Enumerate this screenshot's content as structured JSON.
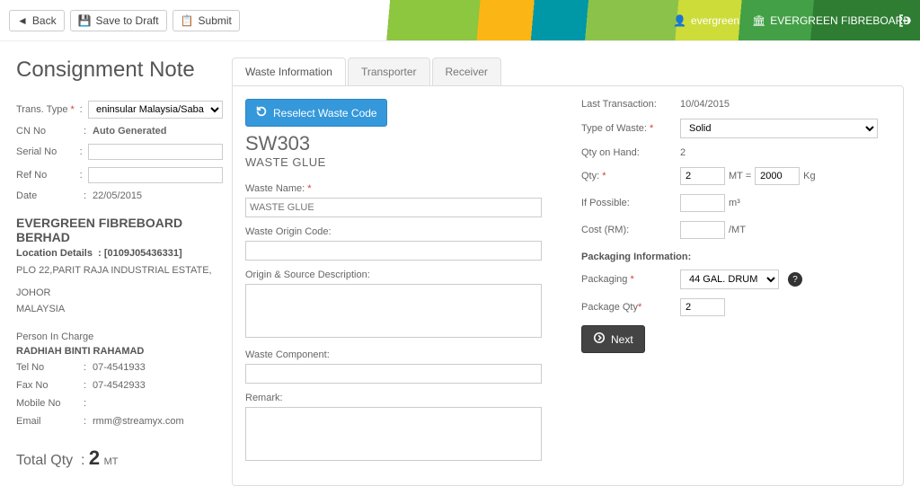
{
  "topbar": {
    "back": "Back",
    "save_draft": "Save to Draft",
    "submit": "Submit",
    "username": "evergreen",
    "orgname": "EVERGREEN FIBREBOARD"
  },
  "left": {
    "title": "Consignment Note",
    "fields": {
      "trans_type_label": "Trans. Type",
      "trans_type_value": "eninsular Malaysia/Sabah/Sarawak",
      "cn_no_label": "CN No",
      "cn_no_value": "Auto Generated",
      "serial_label": "Serial No",
      "serial_value": "",
      "ref_label": "Ref No",
      "ref_value": "",
      "date_label": "Date",
      "date_value": "22/05/2015"
    },
    "company": "EVERGREEN FIBREBOARD BERHAD",
    "location_label": "Location Details",
    "location_code": "[0109J05436331]",
    "address_line1": "PLO 22,PARIT RAJA INDUSTRIAL ESTATE,",
    "address_line2": "JOHOR",
    "address_line3": "MALAYSIA",
    "pic_label": "Person In Charge",
    "pic_name": "RADHIAH BINTI RAHAMAD",
    "contact": {
      "tel_label": "Tel No",
      "tel_value": "07-4541933",
      "fax_label": "Fax No",
      "fax_value": "07-4542933",
      "mobile_label": "Mobile No",
      "mobile_value": "",
      "email_label": "Email",
      "email_value": "rmm@streamyx.com"
    },
    "total_label": "Total Qty",
    "total_value": "2",
    "total_unit": "MT"
  },
  "tabs": {
    "waste": "Waste Information",
    "transporter": "Transporter",
    "receiver": "Receiver"
  },
  "waste": {
    "reselect": "Reselect Waste Code",
    "code": "SW303",
    "code_name": "WASTE GLUE",
    "name_label": "Waste Name:",
    "name_placeholder": "WASTE GLUE",
    "origin_code_label": "Waste Origin Code:",
    "origin_desc_label": "Origin & Source Description:",
    "component_label": "Waste Component:",
    "remark_label": "Remark:"
  },
  "info": {
    "last_trans_label": "Last Transaction:",
    "last_trans_value": "10/04/2015",
    "type_label": "Type of Waste:",
    "type_value": "Solid",
    "qoh_label": "Qty on Hand:",
    "qoh_value": "2",
    "qty_label": "Qty:",
    "qty_value": "2",
    "qty_mt": "MT =",
    "qty_kg_value": "2000",
    "qty_kg_unit": "Kg",
    "possible_label": "If Possible:",
    "possible_unit": "m³",
    "cost_label": "Cost (RM):",
    "cost_unit": "/MT",
    "pack_head": "Packaging Information:",
    "pack_label": "Packaging",
    "pack_value": "44 GAL. DRUM",
    "pack_qty_label": "Package Qty",
    "pack_qty_value": "2",
    "next": "Next"
  }
}
